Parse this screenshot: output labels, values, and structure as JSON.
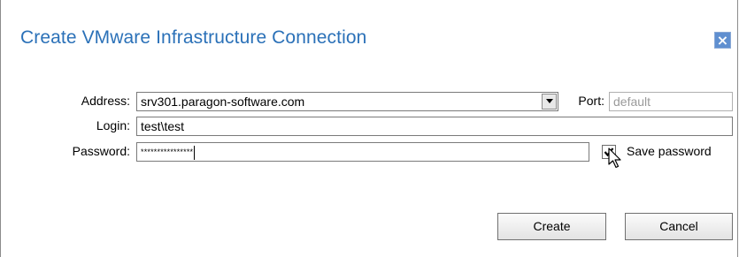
{
  "dialog": {
    "title": "Create VMware Infrastructure Connection",
    "close_glyph": "×"
  },
  "form": {
    "address_label": "Address:",
    "address_value": "srv301.paragon-software.com",
    "port_label": "Port:",
    "port_placeholder": "default",
    "login_label": "Login:",
    "login_value": "test\\test",
    "password_label": "Password:",
    "password_mask": "****************",
    "save_password_label": "Save password",
    "save_password_checked": true
  },
  "buttons": {
    "create_label": "Create",
    "cancel_label": "Cancel"
  },
  "icons": {
    "close": "close-icon",
    "dropdown": "chevron-down-icon",
    "checkmark": "checkmark-icon",
    "cursor": "mouse-pointer-icon"
  },
  "colors": {
    "title": "#2b71b8",
    "close_button": "#5f8fd0"
  }
}
